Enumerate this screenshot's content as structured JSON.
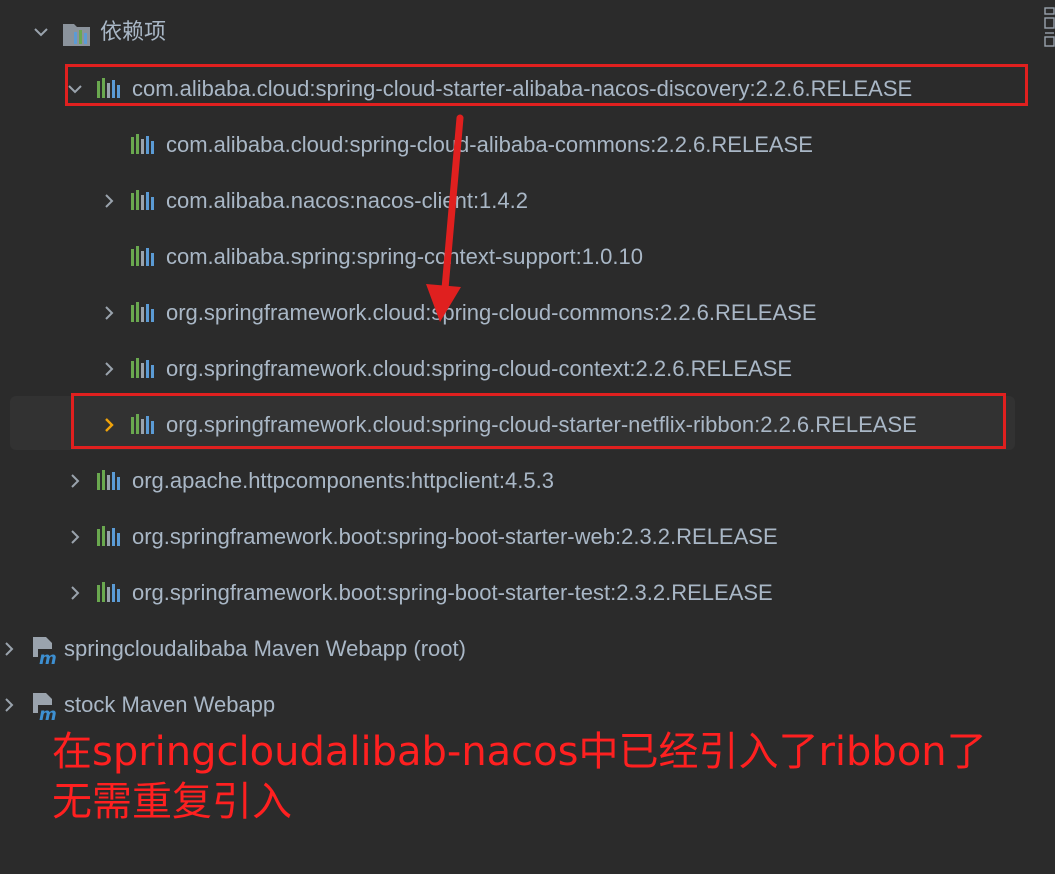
{
  "tree": {
    "group_label": "依赖项",
    "items": [
      {
        "label": "com.alibaba.cloud:spring-cloud-starter-alibaba-nacos-discovery:2.2.6.RELEASE",
        "expanded": true
      },
      {
        "label": "com.alibaba.cloud:spring-cloud-alibaba-commons:2.2.6.RELEASE"
      },
      {
        "label": "com.alibaba.nacos:nacos-client:1.4.2"
      },
      {
        "label": "com.alibaba.spring:spring-context-support:1.0.10"
      },
      {
        "label": "org.springframework.cloud:spring-cloud-commons:2.2.6.RELEASE"
      },
      {
        "label": "org.springframework.cloud:spring-cloud-context:2.2.6.RELEASE"
      },
      {
        "label": "org.springframework.cloud:spring-cloud-starter-netflix-ribbon:2.2.6.RELEASE",
        "selected": true
      },
      {
        "label": "org.apache.httpcomponents:httpclient:4.5.3"
      },
      {
        "label": "org.springframework.boot:spring-boot-starter-web:2.3.2.RELEASE"
      },
      {
        "label": "org.springframework.boot:spring-boot-starter-test:2.3.2.RELEASE"
      }
    ],
    "modules": [
      {
        "label": "springcloudalibaba Maven Webapp (root)"
      },
      {
        "label": "stock Maven Webapp"
      }
    ]
  },
  "annotation": {
    "line1": "在springcloudalibab-nacos中已经引入了ribbon了",
    "line2": "无需重复引入"
  },
  "colors": {
    "background": "#2b2b2b",
    "text": "#a9b7c6",
    "highlight_red": "#e0201f",
    "selected_chevron": "#f0a30a"
  },
  "icons": {
    "library": "library-bars-icon",
    "maven_module": "maven-module-icon",
    "dependencies_folder": "dependencies-folder-icon"
  }
}
